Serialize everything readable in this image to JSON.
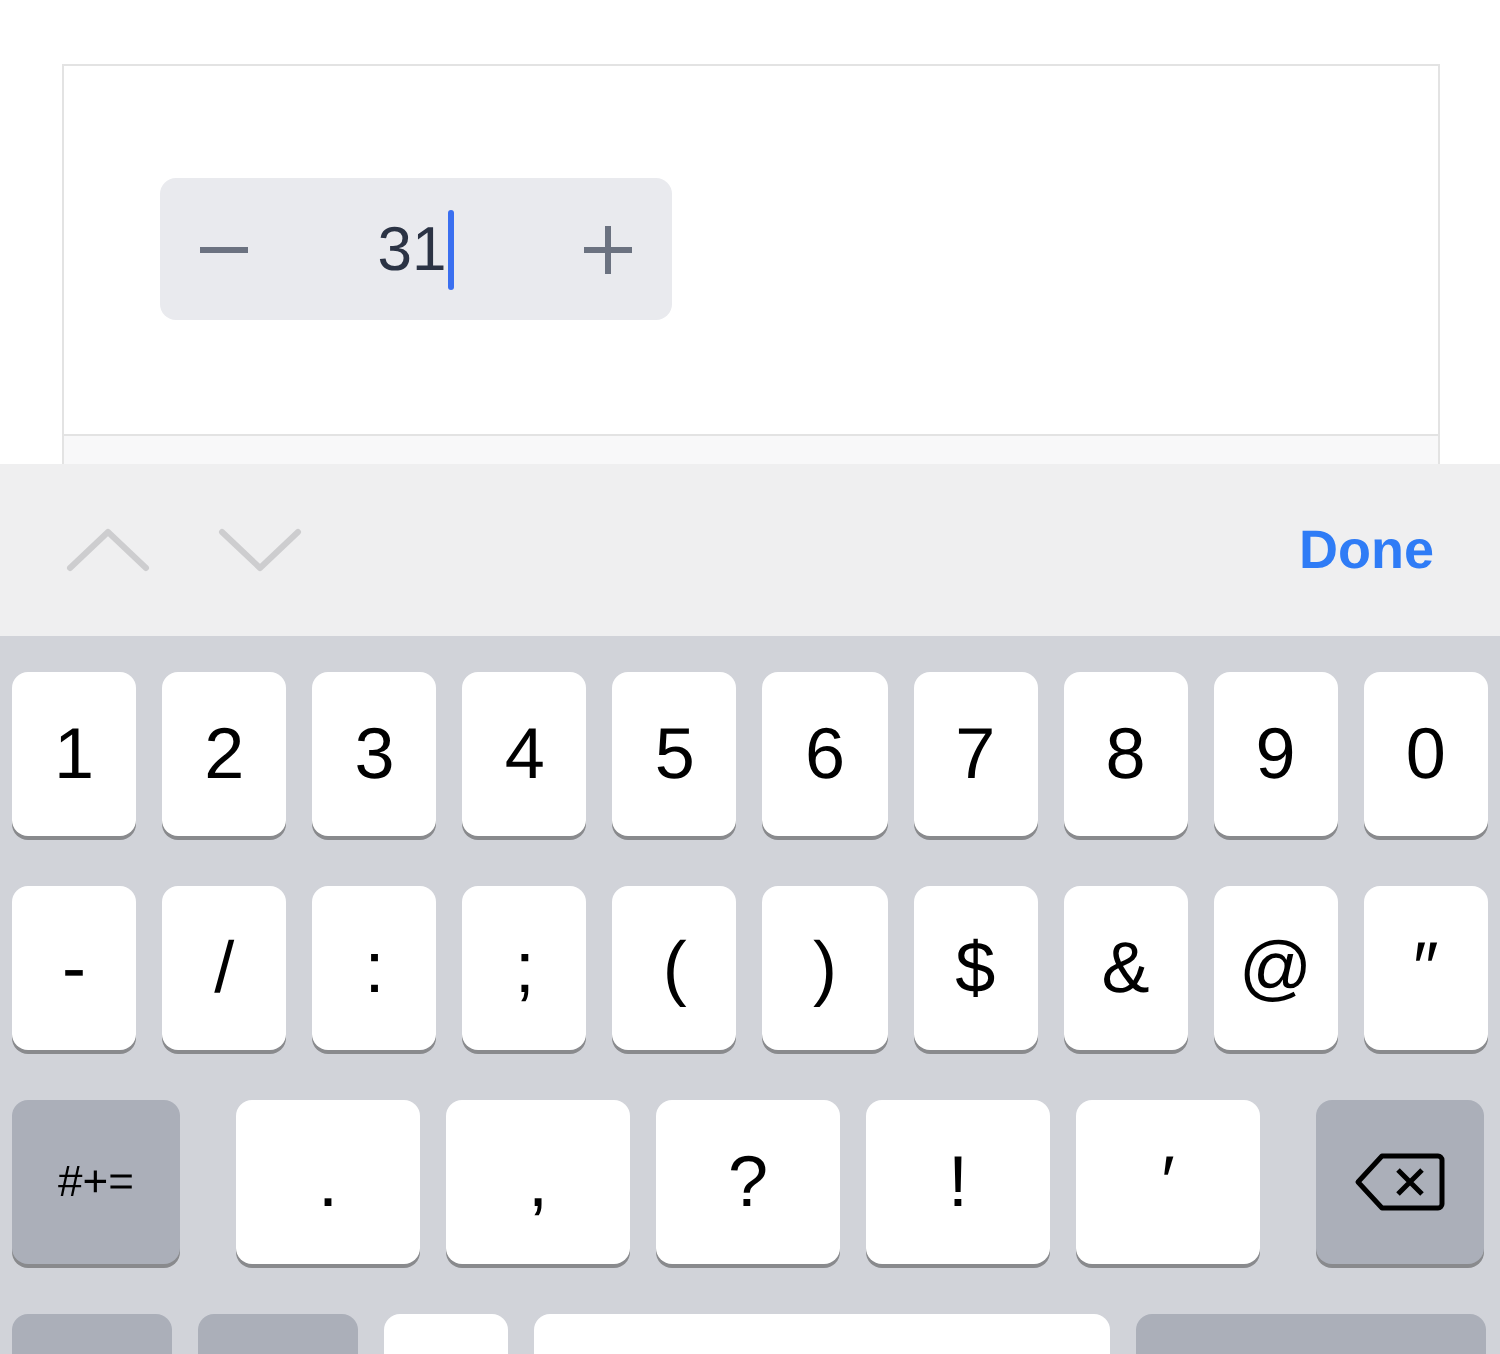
{
  "stepper": {
    "value": "31",
    "focused": true
  },
  "toolbar": {
    "previous": {
      "disabled": true
    },
    "next": {
      "disabled": true
    },
    "done": "Done"
  },
  "keyboard": {
    "rows": [
      {
        "keys": [
          {
            "kind": "char",
            "label": "1"
          },
          {
            "kind": "char",
            "label": "2"
          },
          {
            "kind": "char",
            "label": "3"
          },
          {
            "kind": "char",
            "label": "4"
          },
          {
            "kind": "char",
            "label": "5"
          },
          {
            "kind": "char",
            "label": "6"
          },
          {
            "kind": "char",
            "label": "7"
          },
          {
            "kind": "char",
            "label": "8"
          },
          {
            "kind": "char",
            "label": "9"
          },
          {
            "kind": "char",
            "label": "0"
          }
        ]
      },
      {
        "keys": [
          {
            "kind": "char",
            "label": "-"
          },
          {
            "kind": "char",
            "label": "/"
          },
          {
            "kind": "char",
            "label": ":"
          },
          {
            "kind": "char",
            "label": ";"
          },
          {
            "kind": "char",
            "label": "("
          },
          {
            "kind": "char",
            "label": ")"
          },
          {
            "kind": "char",
            "label": "$"
          },
          {
            "kind": "char",
            "label": "&"
          },
          {
            "kind": "char",
            "label": "@"
          },
          {
            "kind": "char",
            "label": "″"
          }
        ]
      },
      {
        "keys": [
          {
            "kind": "function",
            "label": "#+="
          },
          {
            "kind": "char",
            "label": "."
          },
          {
            "kind": "char",
            "label": ","
          },
          {
            "kind": "char",
            "label": "?"
          },
          {
            "kind": "char",
            "label": "!"
          },
          {
            "kind": "char",
            "label": "′"
          },
          {
            "kind": "delete"
          }
        ]
      },
      {
        "keys": [
          {
            "kind": "function"
          },
          {
            "kind": "function"
          },
          {
            "kind": "char"
          },
          {
            "kind": "space"
          },
          {
            "kind": "return"
          }
        ]
      }
    ]
  }
}
